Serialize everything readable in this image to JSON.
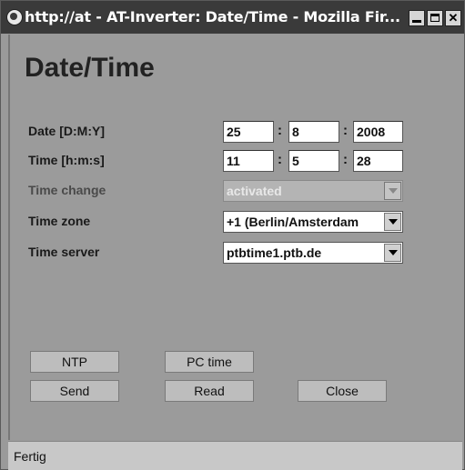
{
  "window": {
    "title": "http://at - AT-Inverter: Date/Time - Mozilla Fir...",
    "icon": "browser-icon"
  },
  "page": {
    "title": "Date/Time"
  },
  "form": {
    "date": {
      "label": "Date [D:M:Y]",
      "day": "25",
      "month": "8",
      "year": "2008",
      "sep": ":"
    },
    "time": {
      "label": "Time [h:m:s]",
      "hour": "11",
      "minute": "5",
      "second": "28",
      "sep": ":"
    },
    "time_change": {
      "label": "Time change",
      "value": "activated",
      "disabled": true
    },
    "time_zone": {
      "label": "Time zone",
      "value": "+1 (Berlin/Amsterdam"
    },
    "time_server": {
      "label": "Time server",
      "value": "ptbtime1.ptb.de"
    }
  },
  "buttons": {
    "ntp": "NTP",
    "pc_time": "PC time",
    "send": "Send",
    "read": "Read",
    "close": "Close"
  },
  "status": {
    "text": "Fertig"
  }
}
